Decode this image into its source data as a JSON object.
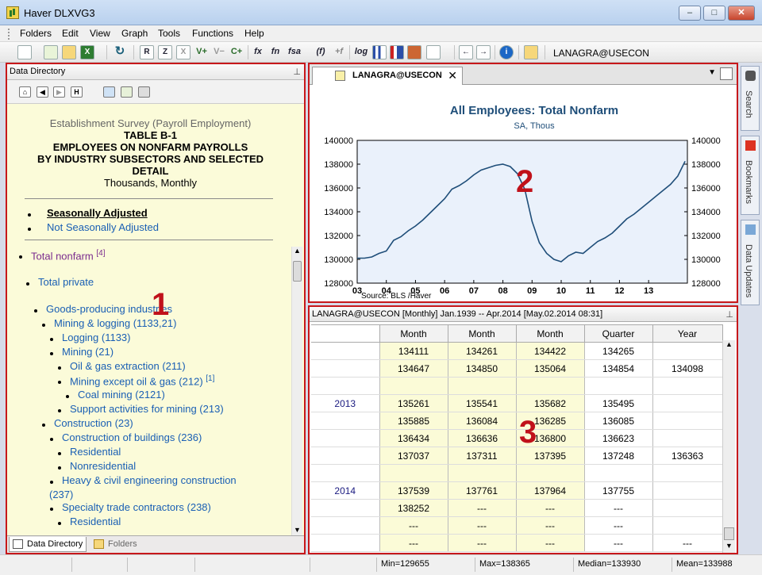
{
  "window": {
    "title": "Haver DLXVG3",
    "min": "–",
    "max": "□",
    "close": "✕"
  },
  "menu": [
    "Folders",
    "Edit",
    "View",
    "Graph",
    "Tools",
    "Functions",
    "Help"
  ],
  "toolbar": {
    "buttons": [
      "R",
      "Z",
      "X",
      "V+",
      "V−",
      "C+",
      "fx",
      "fn",
      "fsa",
      "(f)",
      "+f",
      "log"
    ],
    "series_label": "LANAGRA@USECON"
  },
  "directory": {
    "title": "Data Directory",
    "nav": [
      "⌂",
      "◀",
      "▶",
      "H"
    ],
    "heading": {
      "survey": "Establishment Survey (Payroll Employment)",
      "table": "TABLE B-1",
      "line1": "EMPLOYEES ON NONFARM PAYROLLS",
      "line2": "BY INDUSTRY SUBSECTORS AND SELECTED",
      "line3": "DETAIL",
      "units": "Thousands, Monthly"
    },
    "adjust": [
      "Seasonally Adjusted",
      "Not Seasonally Adjusted"
    ],
    "items": [
      {
        "label": "Total nonfarm",
        "note": "[4]"
      },
      {
        "label": "Total private",
        "note": ""
      },
      {
        "label": "Goods-producing industries",
        "note": ""
      },
      {
        "label": "Mining & logging (1133,21)",
        "note": ""
      },
      {
        "label": "Logging (1133)",
        "note": ""
      },
      {
        "label": "Mining (21)",
        "note": ""
      },
      {
        "label": "Oil & gas extraction (211)",
        "note": ""
      },
      {
        "label": "Mining except oil & gas (212)",
        "note": "[1]"
      },
      {
        "label": "Coal mining (2121)",
        "note": ""
      },
      {
        "label": "Support activities for mining (213)",
        "note": ""
      },
      {
        "label": "Construction (23)",
        "note": ""
      },
      {
        "label": "Construction of buildings (236)",
        "note": ""
      },
      {
        "label": "Residential",
        "note": ""
      },
      {
        "label": "Nonresidential",
        "note": ""
      },
      {
        "label": "Heavy & civil engineering construction",
        "note": ""
      },
      {
        "label": "(237)",
        "note": ""
      },
      {
        "label": "Specialty trade contractors (238)",
        "note": ""
      },
      {
        "label": "Residential",
        "note": ""
      }
    ],
    "tabs": [
      "Data Directory",
      "Folders"
    ]
  },
  "chart_tab": {
    "label": "LANAGRA@USECON",
    "close": "✕"
  },
  "chart_data": {
    "type": "line",
    "title": "All Employees: Total Nonfarm",
    "subtitle": "SA, Thous",
    "source": "Source:  BLS /Haver",
    "x_ticks": [
      "03",
      "04",
      "05",
      "06",
      "07",
      "08",
      "09",
      "10",
      "11",
      "12",
      "13"
    ],
    "y_ticks": [
      128000,
      130000,
      132000,
      134000,
      136000,
      138000,
      140000
    ],
    "ylim": [
      128000,
      140000
    ],
    "xlim": [
      2003.0,
      2014.33
    ],
    "grid": false,
    "color": "#1f4e79",
    "x": [
      2003.0,
      2003.25,
      2003.5,
      2003.75,
      2004.0,
      2004.25,
      2004.5,
      2004.75,
      2005.0,
      2005.25,
      2005.5,
      2005.75,
      2006.0,
      2006.25,
      2006.5,
      2006.75,
      2007.0,
      2007.25,
      2007.5,
      2007.75,
      2008.0,
      2008.25,
      2008.5,
      2008.75,
      2009.0,
      2009.25,
      2009.5,
      2009.75,
      2010.0,
      2010.25,
      2010.5,
      2010.75,
      2011.0,
      2011.25,
      2011.5,
      2011.75,
      2012.0,
      2012.25,
      2012.5,
      2012.75,
      2013.0,
      2013.25,
      2013.5,
      2013.75,
      2014.0,
      2014.25
    ],
    "values": [
      130100,
      130100,
      130200,
      130500,
      130700,
      131600,
      131900,
      132400,
      132800,
      133300,
      133900,
      134500,
      135100,
      135900,
      136200,
      136600,
      137100,
      137500,
      137700,
      137900,
      138000,
      137800,
      137200,
      135900,
      133200,
      131400,
      130500,
      130000,
      129800,
      130300,
      130600,
      130500,
      131000,
      131500,
      131800,
      132200,
      132800,
      133400,
      133800,
      134300,
      134800,
      135300,
      135800,
      136300,
      137000,
      138250
    ]
  },
  "grid": {
    "title": "LANAGRA@USECON    [Monthly]   Jan.1939 -- Apr.2014    [May.02.2014 08:31]",
    "headers": [
      "",
      "Month",
      "Month",
      "Month",
      "Quarter",
      "Year"
    ],
    "rows": [
      [
        "",
        "134111",
        "134261",
        "134422",
        "134265",
        ""
      ],
      [
        "",
        "134647",
        "134850",
        "135064",
        "134854",
        "134098"
      ],
      [
        "",
        "",
        "",
        "",
        "",
        ""
      ],
      [
        "2013",
        "135261",
        "135541",
        "135682",
        "135495",
        ""
      ],
      [
        "",
        "135885",
        "136084",
        "136285",
        "136085",
        ""
      ],
      [
        "",
        "136434",
        "136636",
        "136800",
        "136623",
        ""
      ],
      [
        "",
        "137037",
        "137311",
        "137395",
        "137248",
        "136363"
      ],
      [
        "",
        "",
        "",
        "",
        "",
        ""
      ],
      [
        "2014",
        "137539",
        "137761",
        "137964",
        "137755",
        ""
      ],
      [
        "",
        "138252",
        "---",
        "---",
        "---",
        ""
      ],
      [
        "",
        "---",
        "---",
        "---",
        "---",
        ""
      ],
      [
        "",
        "---",
        "---",
        "---",
        "---",
        "---"
      ]
    ]
  },
  "callouts": [
    "1",
    "2",
    "3"
  ],
  "sidebar": [
    "Search",
    "Bookmarks",
    "Data Updates"
  ],
  "status": {
    "min": "Min=129655",
    "max": "Max=138365",
    "median": "Median=133930",
    "mean": "Mean=133988"
  }
}
